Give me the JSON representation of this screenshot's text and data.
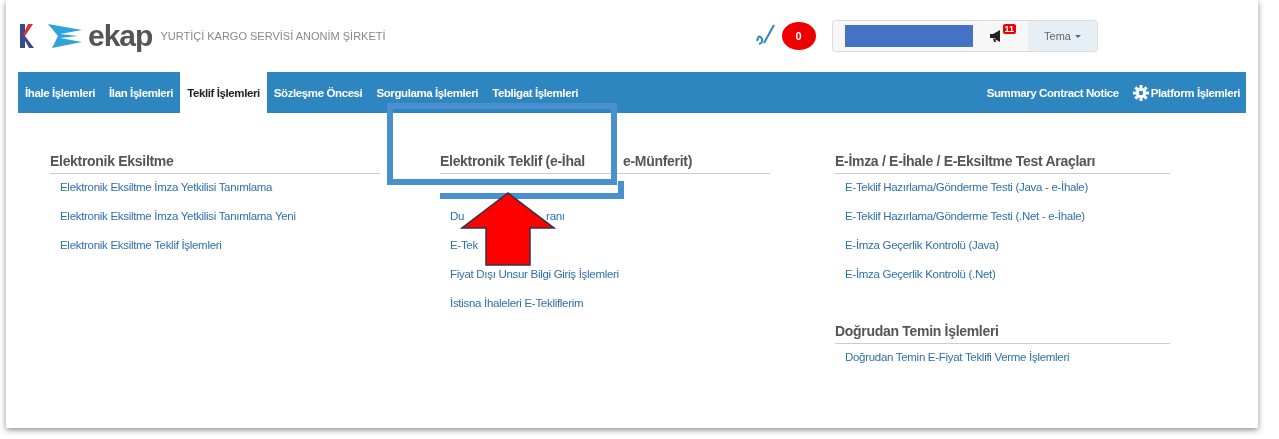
{
  "header": {
    "logo_text": "ekap",
    "company": "YURTİÇİ KARGO SERVİSİ ANONİM ŞİRKETİ",
    "notification_count": "0",
    "announcement_count": "11",
    "theme_button": "Tema"
  },
  "nav": {
    "items": [
      {
        "label": "İhale İşlemleri",
        "selected": false
      },
      {
        "label": "İlan İşlemleri",
        "selected": false
      },
      {
        "label": "Teklif İşlemleri",
        "selected": true
      },
      {
        "label": "Sözleşme Öncesi",
        "selected": false
      },
      {
        "label": "Sorgulama İşlemleri",
        "selected": false
      },
      {
        "label": "Tebligat İşlemleri",
        "selected": false
      }
    ],
    "right_items": [
      {
        "label": "Summary Contract Notice",
        "kind": "link"
      },
      {
        "label": "Platform İşlemleri",
        "kind": "gear"
      }
    ]
  },
  "columns": [
    {
      "sections": [
        {
          "heading": [
            "Elektronik Eksiltme"
          ],
          "links": [
            [
              "Elektronik Eksiltme İmza Yetkilisi Tanımlama"
            ],
            [
              "Elektronik Eksiltme İmza Yetkilisi Tanımlama Yeni"
            ],
            [
              "Elektronik Eksiltme Teklif İşlemleri"
            ]
          ]
        }
      ]
    },
    {
      "sections": [
        {
          "heading": [
            "Elektronik Teklif (e-İhal",
            "e-Münferit)"
          ],
          "links": [
            [
              "Du",
              "ranı"
            ],
            [
              "E-Tek"
            ],
            [
              "Fiyat Dışı Unsur Bilgi Giriş İşlemleri"
            ],
            [
              "İstisna İhaleleri E-Tekliflerim"
            ]
          ]
        }
      ]
    },
    {
      "sections": [
        {
          "heading": [
            "E-İmza / E-İhale / E-Eksiltme Test Araçları"
          ],
          "links": [
            [
              "E-Teklif Hazırlama/Gönderme Testi (Java - e-İhale)"
            ],
            [
              "E-Teklif Hazırlama/Gönderme Testi (.Net - e-İhale)"
            ],
            [
              "E-İmza Geçerlik Kontrolü (Java)"
            ],
            [
              "E-İmza Geçerlik Kontrolü (.Net)"
            ]
          ]
        },
        {
          "heading": [
            "Doğrudan Temin İşlemleri"
          ],
          "links": [
            [
              "Doğrudan Temin E-Fiyat Teklifi Verme İşlemleri"
            ]
          ]
        }
      ]
    }
  ]
}
